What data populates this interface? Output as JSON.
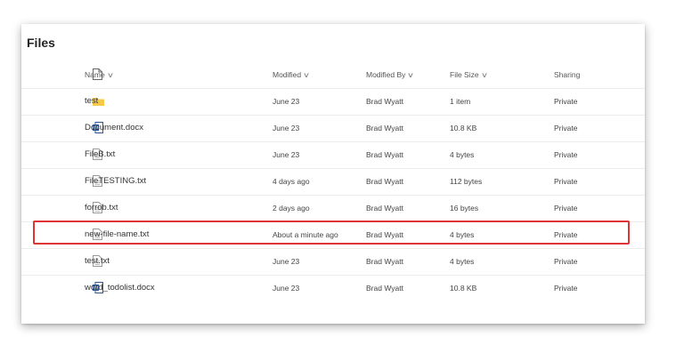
{
  "title": "Files",
  "columns": {
    "name": "Name",
    "modified": "Modified",
    "modified_by": "Modified By",
    "file_size": "File Size",
    "sharing": "Sharing"
  },
  "chevron": "∨",
  "rows": [
    {
      "icon": "folder-icon",
      "name": "test",
      "modified": "June 23",
      "modified_by": "Brad Wyatt",
      "size": "1 item",
      "sharing": "Private"
    },
    {
      "icon": "word-doc-icon",
      "name": "Document.docx",
      "modified": "June 23",
      "modified_by": "Brad Wyatt",
      "size": "10.8 KB",
      "sharing": "Private"
    },
    {
      "icon": "text-file-icon",
      "name": "FileB.txt",
      "modified": "June 23",
      "modified_by": "Brad Wyatt",
      "size": "4 bytes",
      "sharing": "Private"
    },
    {
      "icon": "text-file-icon",
      "name": "FileTESTING.txt",
      "modified": "4 days ago",
      "modified_by": "Brad Wyatt",
      "size": "112 bytes",
      "sharing": "Private"
    },
    {
      "icon": "text-file-icon",
      "name": "forrob.txt",
      "modified": "2 days ago",
      "modified_by": "Brad Wyatt",
      "size": "16 bytes",
      "sharing": "Private"
    },
    {
      "icon": "text-file-icon",
      "name": "new-file-name.txt",
      "modified": "About a minute ago",
      "modified_by": "Brad Wyatt",
      "size": "4 bytes",
      "sharing": "Private"
    },
    {
      "icon": "text-file-icon",
      "name": "test.txt",
      "modified": "June 23",
      "modified_by": "Brad Wyatt",
      "size": "4 bytes",
      "sharing": "Private"
    },
    {
      "icon": "word-doc-icon",
      "name": "word_todolist.docx",
      "modified": "June 23",
      "modified_by": "Brad Wyatt",
      "size": "10.8 KB",
      "sharing": "Private"
    }
  ],
  "colors": {
    "folder": "#f7c948",
    "word": "#2b579a",
    "highlight": "#e03434"
  }
}
